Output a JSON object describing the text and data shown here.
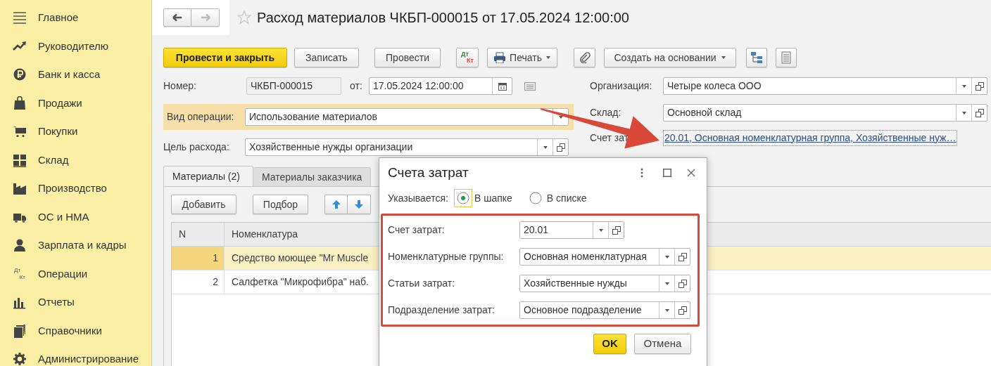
{
  "sidebar": {
    "items": [
      {
        "label": "Главное"
      },
      {
        "label": "Руководителю"
      },
      {
        "label": "Банк и касса"
      },
      {
        "label": "Продажи"
      },
      {
        "label": "Покупки"
      },
      {
        "label": "Склад"
      },
      {
        "label": "Производство"
      },
      {
        "label": "ОС и НМА"
      },
      {
        "label": "Зарплата и кадры"
      },
      {
        "label": "Операции",
        "icon_text": {
          "top": "Дт",
          "bottom": "Кт"
        }
      },
      {
        "label": "Отчеты"
      },
      {
        "label": "Справочники"
      },
      {
        "label": "Администрирование"
      }
    ]
  },
  "nav": [
    {
      "kind": "back",
      "disabled": false
    },
    {
      "kind": "forward",
      "disabled": true
    }
  ],
  "document": {
    "title": "Расход материалов ЧКБП-000015 от 17.05.2024 12:00:00",
    "favorite": false
  },
  "toolbar": [
    {
      "kind": "primary",
      "label": "Провести и закрыть"
    },
    {
      "kind": "plain",
      "label": "Записать"
    },
    {
      "kind": "plain",
      "label": "Провести"
    },
    {
      "kind": "dtkt",
      "top": "Дт",
      "bottom": "Кт"
    },
    {
      "kind": "print",
      "label": "Печать"
    },
    {
      "kind": "clip"
    },
    {
      "kind": "menu",
      "label": "Создать на основании"
    },
    {
      "kind": "structure"
    },
    {
      "kind": "report"
    }
  ],
  "form": {
    "number": {
      "label": "Номер:",
      "value": "ЧКБП-000015"
    },
    "date": {
      "label": "от:",
      "value": "17.05.2024 12:00:00"
    },
    "operation": {
      "label": "Вид операции:",
      "value": "Использование материалов",
      "highlighted": true
    },
    "purpose": {
      "label": "Цель расхода:",
      "value": "Хозяйственные нужды организации"
    },
    "organization": {
      "label": "Организация:",
      "value": "Четыре колеса ООО"
    },
    "warehouse": {
      "label": "Склад:",
      "value": "Основной склад"
    },
    "cost_account": {
      "label": "Счет зат",
      "link": "20.01, Основная номенклатурная группа, Хозяйственные нуж…"
    }
  },
  "tabs": [
    {
      "label": "Материалы (2)",
      "selected": true
    },
    {
      "label": "Материалы заказчика",
      "selected": false
    }
  ],
  "table_buttons": [
    "Добавить",
    "Подбор"
  ],
  "table": {
    "columns": [
      "N",
      "Номенклатура"
    ],
    "rows": [
      {
        "n": "1",
        "item": "Средство моющее \"Mr Muscle",
        "selected": true
      },
      {
        "n": "2",
        "item": "Салфетка \"Микрофибра\" наб.",
        "selected": false
      }
    ]
  },
  "dialog": {
    "title": "Счета затрат",
    "mode_label": "Указывается:",
    "options": [
      {
        "label": "В шапке",
        "selected": true
      },
      {
        "label": "В списке",
        "selected": false
      }
    ],
    "fields": [
      {
        "kind": "short",
        "label": "Счет затрат:",
        "value": "20.01"
      },
      {
        "kind": "wide",
        "label": "Номенклатурные группы:",
        "value": "Основная номенклатурная"
      },
      {
        "kind": "wide",
        "label": "Статьи затрат:",
        "value": "Хозяйственные нужды"
      },
      {
        "kind": "wide",
        "label": "Подразделение затрат:",
        "value": "Основное подразделение"
      }
    ],
    "buttons": [
      {
        "kind": "primary",
        "label": "OK"
      },
      {
        "kind": "plain",
        "label": "Отмена"
      }
    ]
  }
}
